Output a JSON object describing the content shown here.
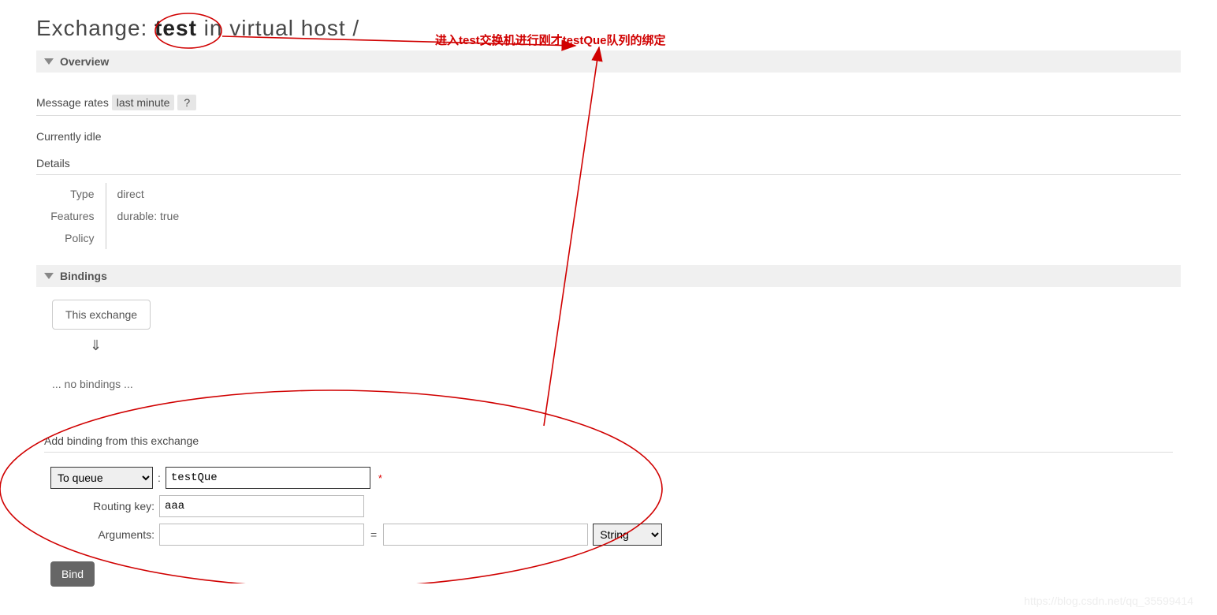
{
  "title": {
    "prefix": "Exchange: ",
    "name": "test",
    "suffix": " in virtual host /"
  },
  "annotation": {
    "text": "进入test交换机进行刚才testQue队列的绑定"
  },
  "overview": {
    "label": "Overview",
    "message_rates_label": "Message rates",
    "message_rates_value": "last minute",
    "help": "?",
    "idle": "Currently idle",
    "details_label": "Details",
    "details": {
      "type_key": "Type",
      "type_val": "direct",
      "features_key": "Features",
      "features_val": "durable: true",
      "policy_key": "Policy",
      "policy_val": ""
    }
  },
  "bindings": {
    "label": "Bindings",
    "this_exchange": "This exchange",
    "arrow": "⇓",
    "no_bindings": "... no bindings ...",
    "add_label": "Add binding from this exchange",
    "form": {
      "to_select": "To queue",
      "queue_value": "testQue",
      "routing_key_label": "Routing key:",
      "routing_key_value": "aaa",
      "arguments_label": "Arguments:",
      "arg_key": "",
      "arg_val": "",
      "eq": "=",
      "type_select": "String",
      "req": "*",
      "bind_btn": "Bind",
      "colon": ":"
    }
  },
  "watermark": "https://blog.csdn.net/qq_35599414"
}
